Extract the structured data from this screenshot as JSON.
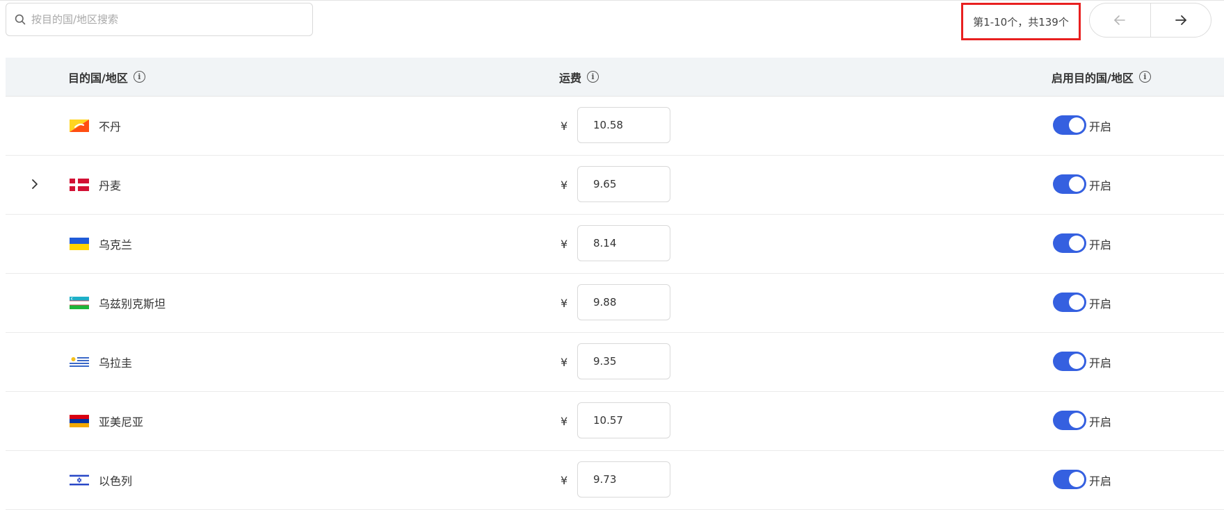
{
  "search": {
    "placeholder": "按目的国/地区搜索",
    "value": ""
  },
  "pagination": {
    "info": "第1-10个，共139个",
    "prev_icon": "arrow-left-icon",
    "next_icon": "arrow-right-icon"
  },
  "table": {
    "columns": {
      "destination": "目的国/地区",
      "fee": "运费",
      "enabled": "启用目的国/地区"
    },
    "currency_symbol": "¥",
    "toggle_label": "开启",
    "toggle_color": "#3560e0",
    "rows": [
      {
        "country": "不丹",
        "flag": "bhutan-flag-icon",
        "fee": "10.58",
        "expandable": false,
        "enabled": true
      },
      {
        "country": "丹麦",
        "flag": "denmark-flag-icon",
        "fee": "9.65",
        "expandable": true,
        "enabled": true
      },
      {
        "country": "乌克兰",
        "flag": "ukraine-flag-icon",
        "fee": "8.14",
        "expandable": false,
        "enabled": true
      },
      {
        "country": "乌兹别克斯坦",
        "flag": "uzbekistan-flag-icon",
        "fee": "9.88",
        "expandable": false,
        "enabled": true
      },
      {
        "country": "乌拉圭",
        "flag": "uruguay-flag-icon",
        "fee": "9.35",
        "expandable": false,
        "enabled": true
      },
      {
        "country": "亚美尼亚",
        "flag": "armenia-flag-icon",
        "fee": "10.57",
        "expandable": false,
        "enabled": true
      },
      {
        "country": "以色列",
        "flag": "israel-flag-icon",
        "fee": "9.73",
        "expandable": false,
        "enabled": true
      }
    ]
  },
  "highlight_color": "#e82020"
}
